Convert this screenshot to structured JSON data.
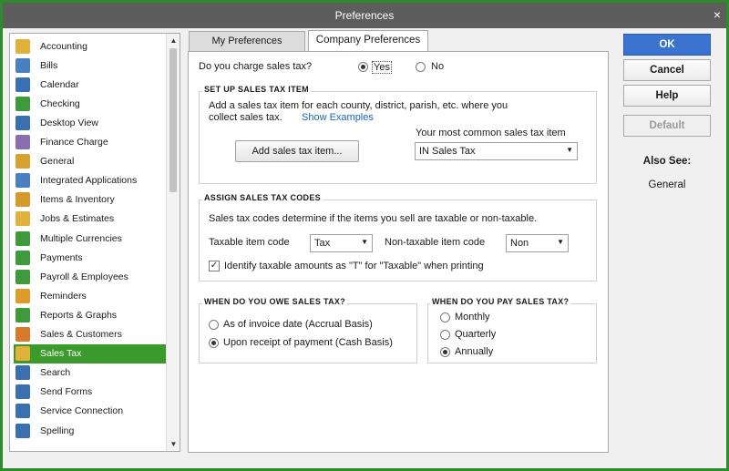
{
  "window": {
    "title": "Preferences",
    "close_glyph": "×"
  },
  "sidebar": {
    "items": [
      {
        "label": "Accounting",
        "icon": "accounting-icon",
        "color": "#e0b23a"
      },
      {
        "label": "Bills",
        "icon": "bills-icon",
        "color": "#4a7fc1"
      },
      {
        "label": "Calendar",
        "icon": "calendar-icon",
        "color": "#3b6fb5"
      },
      {
        "label": "Checking",
        "icon": "checking-icon",
        "color": "#3e9a3a"
      },
      {
        "label": "Desktop View",
        "icon": "desktop-view-icon",
        "color": "#3a6fb0"
      },
      {
        "label": "Finance Charge",
        "icon": "finance-charge-icon",
        "color": "#8a6fb0"
      },
      {
        "label": "General",
        "icon": "general-icon",
        "color": "#d9a12e"
      },
      {
        "label": "Integrated Applications",
        "icon": "integrated-apps-icon",
        "color": "#4a7fc1"
      },
      {
        "label": "Items & Inventory",
        "icon": "items-inventory-icon",
        "color": "#d79a2a"
      },
      {
        "label": "Jobs & Estimates",
        "icon": "jobs-estimates-icon",
        "color": "#e0b23a"
      },
      {
        "label": "Multiple Currencies",
        "icon": "multiple-currencies-icon",
        "color": "#3e9a3a"
      },
      {
        "label": "Payments",
        "icon": "payments-icon",
        "color": "#3e9a3a"
      },
      {
        "label": "Payroll & Employees",
        "icon": "payroll-employees-icon",
        "color": "#3e9a3a"
      },
      {
        "label": "Reminders",
        "icon": "reminders-icon",
        "color": "#e09a2a"
      },
      {
        "label": "Reports & Graphs",
        "icon": "reports-graphs-icon",
        "color": "#3e9a3a"
      },
      {
        "label": "Sales & Customers",
        "icon": "sales-customers-icon",
        "color": "#d97a2a"
      },
      {
        "label": "Sales Tax",
        "icon": "sales-tax-icon",
        "color": "#e0b23a",
        "selected": true
      },
      {
        "label": "Search",
        "icon": "search-icon",
        "color": "#3a6fb0"
      },
      {
        "label": "Send Forms",
        "icon": "send-forms-icon",
        "color": "#3a6fb0"
      },
      {
        "label": "Service Connection",
        "icon": "service-connection-icon",
        "color": "#3a6fb0"
      },
      {
        "label": "Spelling",
        "icon": "spelling-icon",
        "color": "#3a6fb0"
      }
    ],
    "scroll_up_glyph": "▲",
    "scroll_down_glyph": "▼"
  },
  "tabs": {
    "my_prefs": "My Preferences",
    "company_prefs": "Company Preferences"
  },
  "main": {
    "charge_question": "Do you charge sales tax?",
    "yes_label": "Yes",
    "no_label": "No",
    "setup": {
      "title": "SET UP SALES TAX ITEM",
      "desc_line1": "Add a sales tax item for each county, district, parish, etc. where you",
      "desc_line2": "collect sales tax.",
      "show_examples": "Show Examples",
      "add_button": "Add sales tax item...",
      "common_label": "Your most common sales tax item",
      "common_value": "IN Sales Tax"
    },
    "codes": {
      "title": "ASSIGN SALES TAX CODES",
      "desc": "Sales tax codes determine if the items you sell are taxable or non-taxable.",
      "taxable_label": "Taxable item code",
      "taxable_value": "Tax",
      "nontaxable_label": "Non-taxable item code",
      "nontaxable_value": "Non",
      "identify_label": "Identify taxable amounts as \"T\" for \"Taxable\" when printing",
      "identify_checked": "✓"
    },
    "owe": {
      "title": "WHEN DO YOU OWE SALES TAX?",
      "accrual": "As of invoice date (Accrual Basis)",
      "cash": "Upon receipt of payment (Cash Basis)"
    },
    "pay": {
      "title": "WHEN DO YOU PAY SALES TAX?",
      "monthly": "Monthly",
      "quarterly": "Quarterly",
      "annually": "Annually"
    },
    "dropdown_glyph": "▼"
  },
  "right": {
    "ok": "OK",
    "cancel": "Cancel",
    "help": "Help",
    "default": "Default",
    "also_see": "Also See:",
    "also_see_link": "General"
  },
  "colors": {
    "accent": "#3a9a2b",
    "primary_button": "#3b73d1",
    "window_border": "#2d8a2d"
  }
}
